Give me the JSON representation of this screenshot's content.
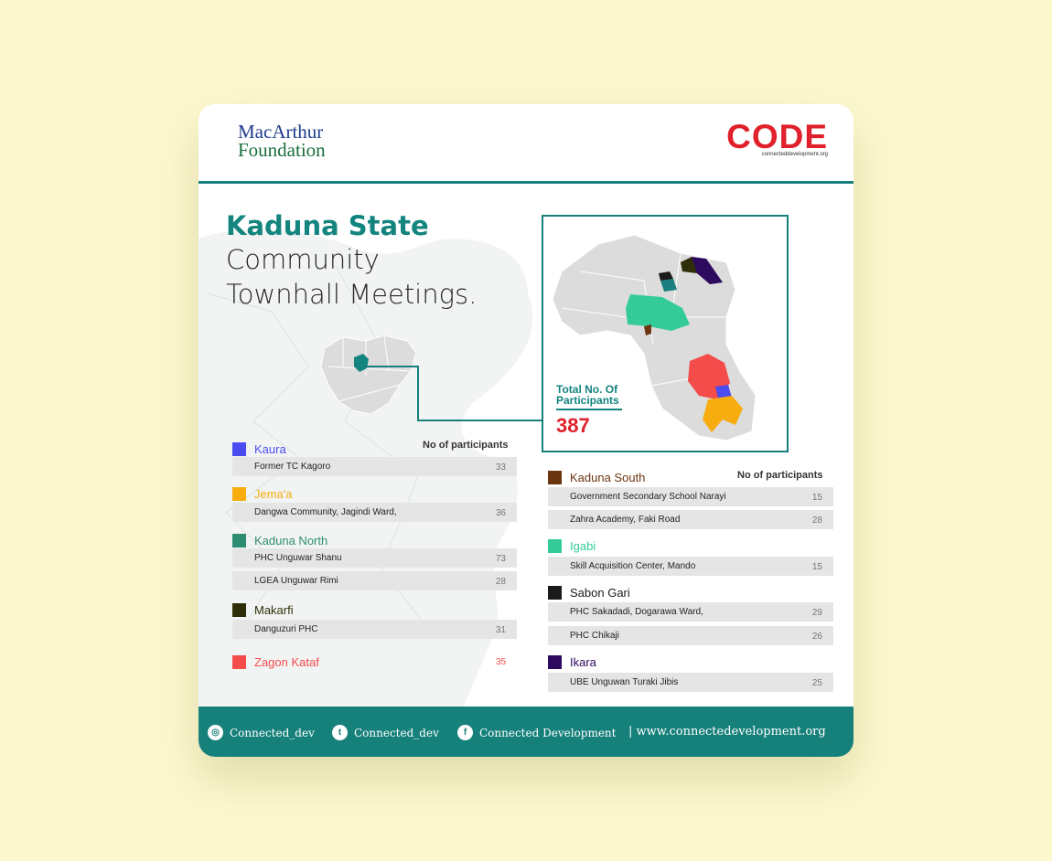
{
  "logos": {
    "macarthur_line1": "MacArthur",
    "macarthur_line2": "Foundation",
    "code_text": "CODE",
    "code_tagline": "connecteddevelopment.org"
  },
  "title": {
    "line1": "Kaduna State",
    "line2": "Community",
    "line3": "Townhall Meetings."
  },
  "total": {
    "label_line1": "Total No. Of",
    "label_line2": "Participants",
    "value": "387"
  },
  "column_header": "No of participants",
  "left_groups": [
    {
      "name": "Kaura",
      "color": "#4a4cf0",
      "sites": [
        {
          "name": "Former TC Kagoro",
          "count": "33"
        }
      ]
    },
    {
      "name": "Jema'a",
      "color": "#f7ad10",
      "sites": [
        {
          "name": "Dangwa Community, Jagindi Ward,",
          "count": "36"
        }
      ]
    },
    {
      "name": "Kaduna North",
      "color": "#2e8c72",
      "sites": [
        {
          "name": "PHC Unguwar Shanu",
          "count": "73"
        },
        {
          "name": "LGEA Unguwar Rimi",
          "count": "28"
        }
      ]
    },
    {
      "name": "Makarfi",
      "color": "#2e2e08",
      "sites": [
        {
          "name": "Danguzuri PHC",
          "count": "31"
        }
      ]
    },
    {
      "name": "Zagon Kataf",
      "color": "#f44b4b",
      "count": "35"
    }
  ],
  "right_groups": [
    {
      "name": "Kaduna South",
      "color": "#6b3510",
      "sites": [
        {
          "name": "Government Secondary School Narayi",
          "count": "15"
        },
        {
          "name": "Zahra Academy, Faki Road",
          "count": "28"
        }
      ]
    },
    {
      "name": "Igabi",
      "color": "#33cc99",
      "sites": [
        {
          "name": "Skill Acquisition Center, Mando",
          "count": "15"
        }
      ]
    },
    {
      "name": "Sabon Gari",
      "color": "#1a1a1a",
      "sites": [
        {
          "name": "PHC Sakadadi, Dogarawa Ward,",
          "count": "29"
        },
        {
          "name": "PHC Chikaji",
          "count": "26"
        }
      ]
    },
    {
      "name": "Ikara",
      "color": "#2d0a5e",
      "sites": [
        {
          "name": "UBE Unguwan Turaki Jibis",
          "count": "25"
        }
      ]
    }
  ],
  "footer": {
    "instagram": "Connected_dev",
    "twitter": "Connected_dev",
    "facebook": "Connected Development",
    "website": "| www.connectedevelopment.org"
  },
  "colors": {
    "teal": "#16807a",
    "red": "#e0202a",
    "background": "#fdf9cf"
  }
}
